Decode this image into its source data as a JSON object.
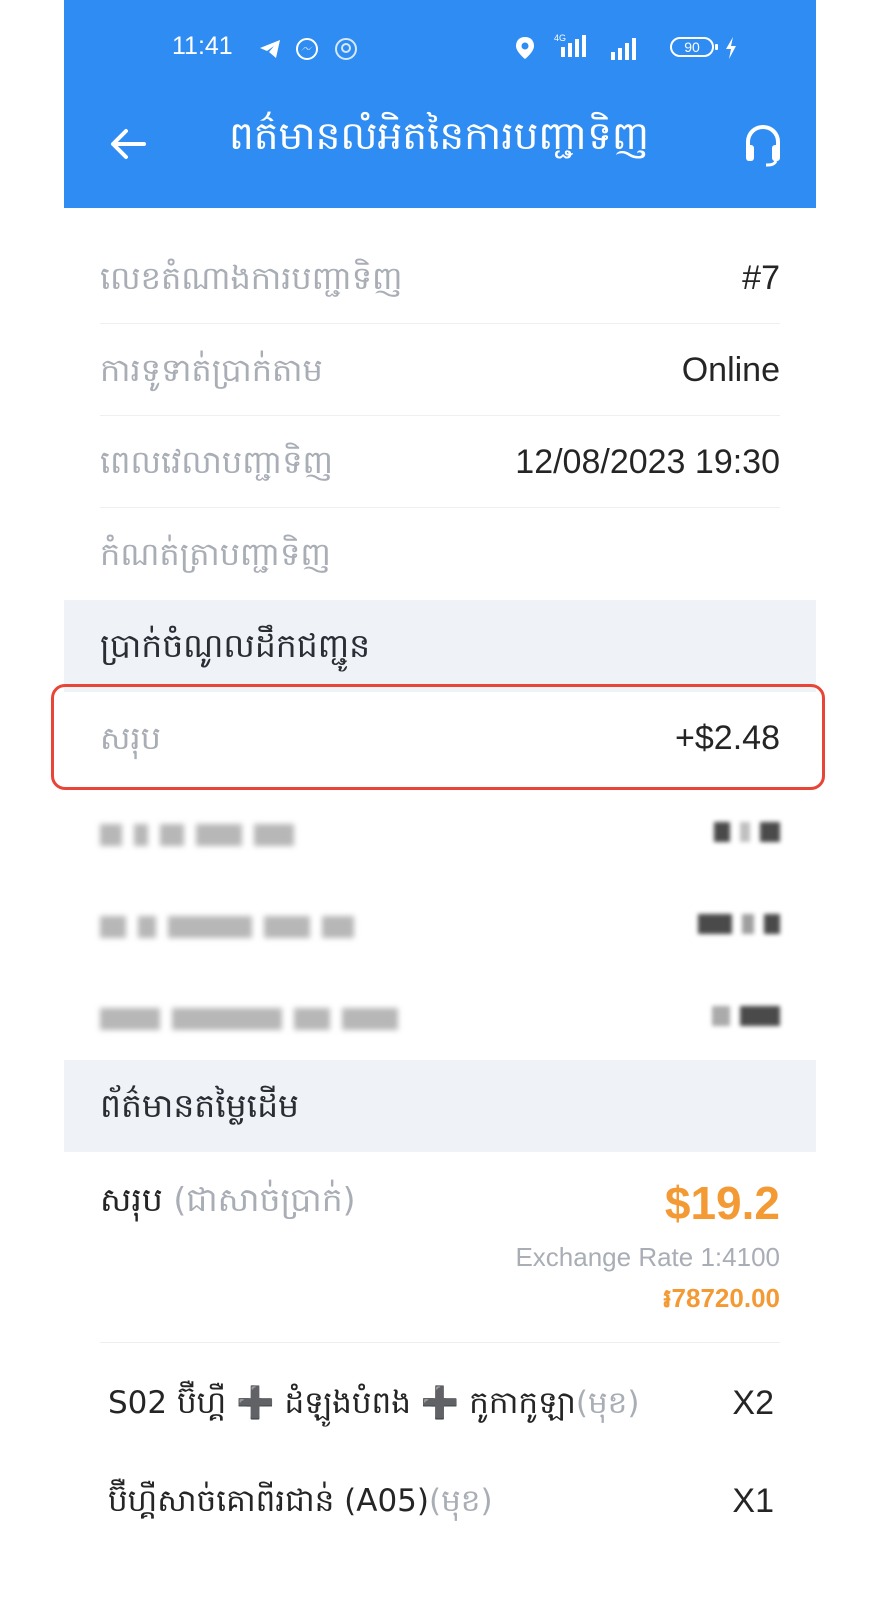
{
  "status": {
    "time": "11:41",
    "battery": "90"
  },
  "header": {
    "title": "ពត៌មានលំអិតនៃការបញ្ជាទិញ"
  },
  "order_info": [
    {
      "label": "លេខតំណាងការបញ្ជាទិញ",
      "value": "#7"
    },
    {
      "label": "ការទូទាត់ប្រាក់តាម",
      "value": "Online"
    },
    {
      "label": "ពេលវេលាបញ្ជាទិញ",
      "value": "12/08/2023 19:30"
    },
    {
      "label": "កំណត់ត្រាបញ្ជាទិញ",
      "value": ""
    }
  ],
  "delivery_section": {
    "title": "ប្រាក់ចំណូលដឹកជញ្ជូន",
    "total_label": "សរុប",
    "total_value": "+$2.48"
  },
  "cost_section": {
    "title": "ព័ត៌មានតម្លៃដើម",
    "summary_label": "សរុប",
    "summary_note": "(ជាសាច់ប្រាក់)",
    "amount": "$19.2",
    "exchange_rate": "Exchange Rate 1:4100",
    "riel_amount": "៛78720.00"
  },
  "items": [
    {
      "name": "S02 ប៊ឺហ្គឺ ➕ ដំឡូងបំពង ➕ កូកាកូឡា",
      "note": "(មុខ)",
      "qty": "X2"
    },
    {
      "name": "ប៊ឺហ្គឺសាច់គោពីរជាន់ (A05)",
      "note": "(មុខ)",
      "qty": "X1"
    }
  ],
  "colors": {
    "header_blue": "#2f8cf2",
    "accent_orange": "#f39a35",
    "highlight_red": "#e94536"
  }
}
